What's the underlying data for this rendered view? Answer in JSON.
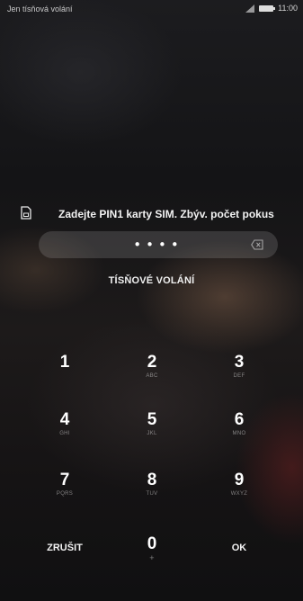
{
  "status_bar": {
    "carrier_text": "Jen tísňová volání",
    "time": "11:00",
    "icons": [
      "signal-icon",
      "battery-icon"
    ]
  },
  "sim_prompt": {
    "icon": "sim-card-icon",
    "text": "Zadejte PIN1 karty SIM. Zbýv. počet pokus"
  },
  "pin_field": {
    "masked_value": "••••",
    "clear_icon": "backspace-icon"
  },
  "emergency_label": "TÍSŇOVÉ VOLÁNÍ",
  "keypad": {
    "keys": [
      {
        "digit": "1",
        "letters": ""
      },
      {
        "digit": "2",
        "letters": "ABC"
      },
      {
        "digit": "3",
        "letters": "DEF"
      },
      {
        "digit": "4",
        "letters": "GHI"
      },
      {
        "digit": "5",
        "letters": "JKL"
      },
      {
        "digit": "6",
        "letters": "MNO"
      },
      {
        "digit": "7",
        "letters": "PQRS"
      },
      {
        "digit": "8",
        "letters": "TUV"
      },
      {
        "digit": "9",
        "letters": "WXYZ"
      },
      {
        "digit": "0",
        "letters": "+"
      }
    ],
    "cancel_label": "ZRUŠIT",
    "ok_label": "OK"
  }
}
